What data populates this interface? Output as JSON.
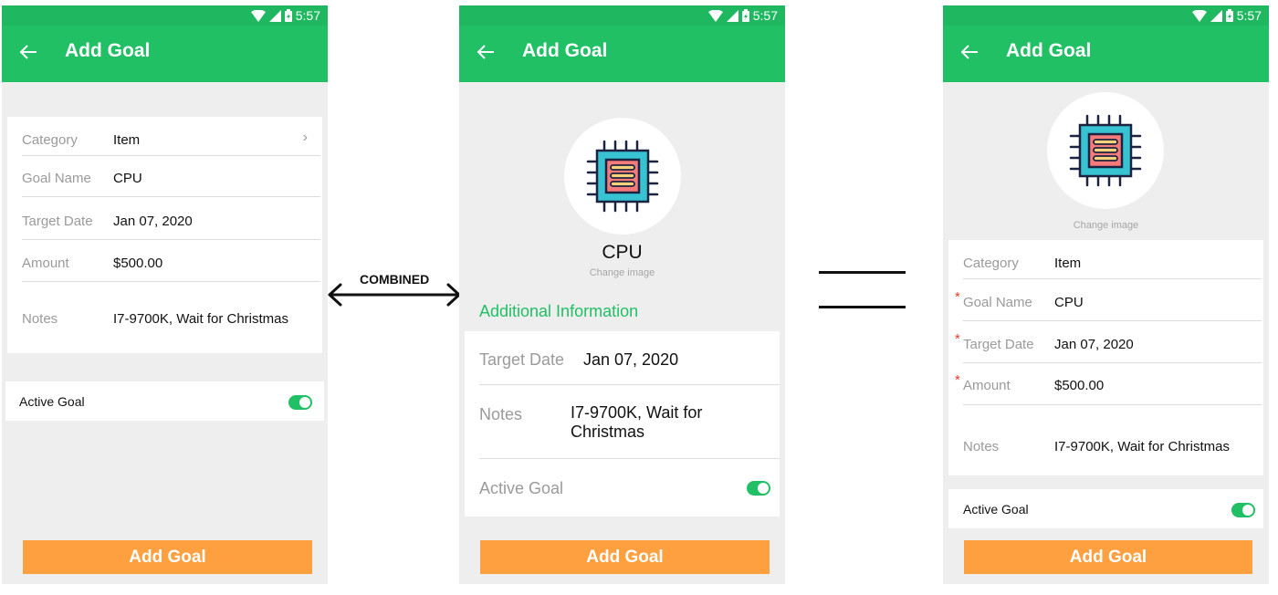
{
  "status": {
    "time": "5:57"
  },
  "colors": {
    "green_bar": "#21c065",
    "status_green": "#1fb860",
    "orange_button": "#ffa040",
    "required_star": "#e0412b"
  },
  "icons": {
    "back": "arrow-left-icon",
    "chevron": "chevron-right-icon",
    "chip": "cpu-chip-icon"
  },
  "connector": {
    "label": "COMBINED"
  },
  "phone1": {
    "title": "Add Goal",
    "fields": [
      {
        "label": "Category",
        "value": "Item"
      },
      {
        "label": "Goal Name",
        "value": "CPU"
      },
      {
        "label": "Target Date",
        "value": "Jan 07, 2020"
      },
      {
        "label": "Amount",
        "value": "$500.00"
      },
      {
        "label": "Notes",
        "value": "I7-9700K, Wait for Christmas"
      }
    ],
    "chevron": "›",
    "active_label": "Active Goal",
    "active_on": true,
    "button": "Add Goal"
  },
  "phone2": {
    "title": "Add Goal",
    "goal_name": "CPU",
    "change_image": "Change image",
    "section": "Additional Information",
    "fields": [
      {
        "label": "Target Date",
        "value": "Jan 07, 2020"
      },
      {
        "label": "Notes",
        "value": "I7-9700K, Wait for Christmas"
      }
    ],
    "active_label": "Active Goal",
    "active_on": true,
    "button": "Add Goal"
  },
  "phone3": {
    "title": "Add Goal",
    "change_image": "Change image",
    "required_mark": "*",
    "fields": [
      {
        "label": "Category",
        "value": "Item"
      },
      {
        "label": "Goal Name",
        "value": "CPU"
      },
      {
        "label": "Target Date",
        "value": "Jan 07, 2020"
      },
      {
        "label": "Amount",
        "value": "$500.00"
      },
      {
        "label": "Notes",
        "value": "I7-9700K, Wait for Christmas"
      }
    ],
    "active_label": "Active Goal",
    "active_on": true,
    "button": "Add Goal"
  }
}
